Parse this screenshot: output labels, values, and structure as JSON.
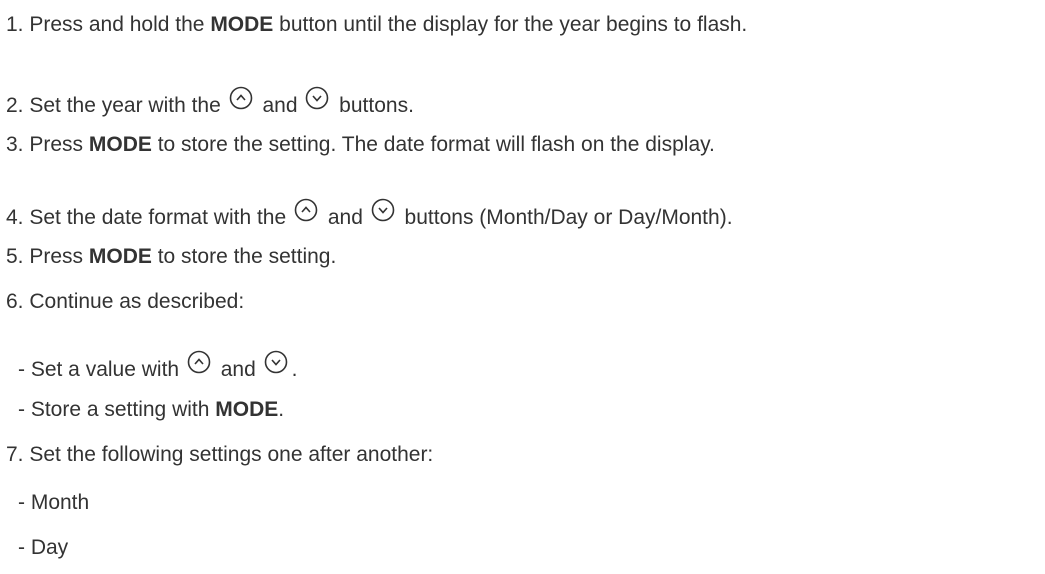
{
  "steps": {
    "s1": {
      "pre": "1. Press and hold the ",
      "bold": "MODE",
      "post": " button until the display for the year begins to flash."
    },
    "s2": {
      "pre": "2. Set the year with the ",
      "mid": " and ",
      "post": " buttons."
    },
    "s3": {
      "pre": "3. Press ",
      "bold": "MODE",
      "post": " to store the setting. The date format will flash on the display."
    },
    "s4": {
      "pre": "4. Set the date format with the ",
      "mid": " and ",
      "post": "  buttons (Month/Day or Day/Month)."
    },
    "s5": {
      "pre": "5. Press ",
      "bold": "MODE",
      "post": " to store the setting."
    },
    "s6": {
      "text": "6. Continue as described:"
    },
    "s6a": {
      "pre": "- Set a value with ",
      "mid": " and ",
      "post": "."
    },
    "s6b": {
      "pre": "- Store a setting with ",
      "bold": "MODE",
      "post": "."
    },
    "s7": {
      "text": "7. Set the following settings one after another:"
    },
    "s7a": {
      "text": "- Month"
    },
    "s7b": {
      "text": "- Day"
    }
  },
  "icons": {
    "up": "up-arrow-button-icon",
    "down": "down-arrow-button-icon",
    "color": "#333333"
  }
}
